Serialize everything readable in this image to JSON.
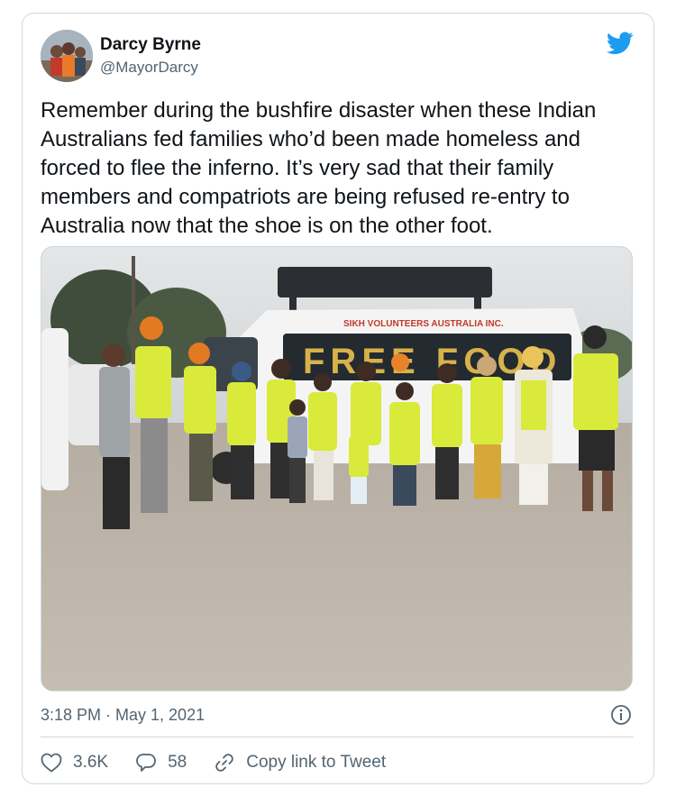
{
  "author": {
    "display_name": "Darcy Byrne",
    "handle": "@MayorDarcy"
  },
  "tweet": {
    "text": "Remember during the bushfire disaster when these Indian Australians fed families who’d been made homeless and forced to flee the inferno. It’s very sad that their family members and compatriots are being refused re-entry to Australia now that the shoe is on the other foot.",
    "timestamp": "3:18 PM · May 1, 2021"
  },
  "photo": {
    "van_sign": "SIKH VOLUNTEERS AUSTRALIA INC.",
    "van_banner": "FREE FOOD"
  },
  "actions": {
    "likes_count": "3.6K",
    "replies_count": "58",
    "copy_link_label": "Copy link to Tweet"
  },
  "icons": {
    "brand": "twitter-bird-icon",
    "info": "info-icon",
    "like": "heart-icon",
    "reply": "reply-bubble-icon",
    "link": "link-icon"
  },
  "colors": {
    "brand": "#1d9bf0",
    "secondary_text": "#536471",
    "border": "#cfd9de"
  }
}
